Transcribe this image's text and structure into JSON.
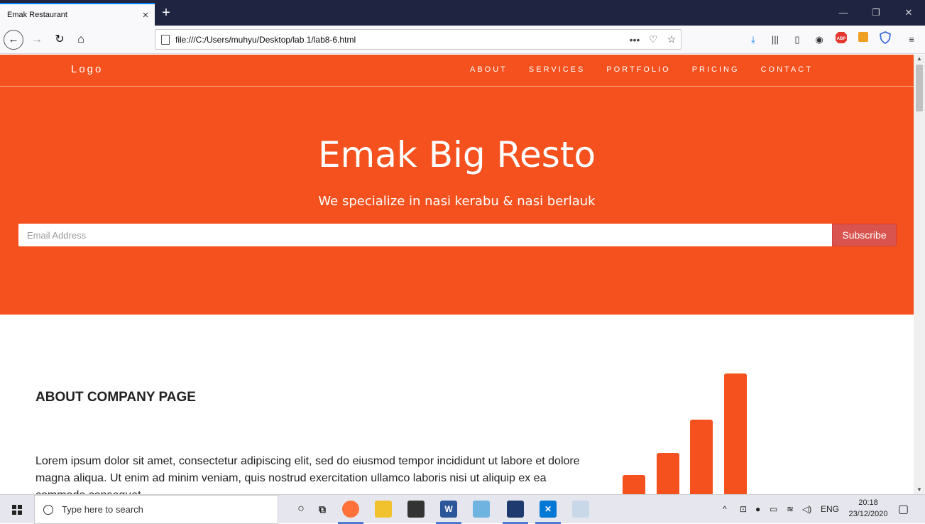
{
  "browser": {
    "tab_title": "Emak Restaurant",
    "tab_close": "×",
    "new_tab": "+",
    "url": "file:///C:/Users/muhyu/Desktop/lab 1/lab8-6.html",
    "url_actions": [
      "•••",
      "♡",
      "☆"
    ],
    "window_controls": [
      "—",
      "❐",
      "✕"
    ]
  },
  "site": {
    "logo": "Logo",
    "menu": [
      "ABOUT",
      "SERVICES",
      "PORTFOLIO",
      "PRICING",
      "CONTACT"
    ],
    "hero_title": "Emak Big Resto",
    "hero_subtitle": "We specialize in nasi kerabu & nasi berlauk",
    "email_placeholder": "Email Address",
    "subscribe_label": "Subscribe",
    "brand_color": "#f4511e",
    "about_title": "ABOUT COMPANY PAGE",
    "about_text": "Lorem ipsum dolor sit amet, consectetur adipiscing elit, sed do eiusmod tempor incididunt ut labore et dolore magna aliqua. Ut enim ad minim veniam, quis nostrud exercitation ullamco laboris nisi ut aliquip ex ea commodo consequat.",
    "signal_icon": "signal-bars-icon"
  },
  "taskbar": {
    "search_placeholder": "Type here to search",
    "language": "ENG",
    "time": "20:18",
    "date": "23/12/2020"
  }
}
